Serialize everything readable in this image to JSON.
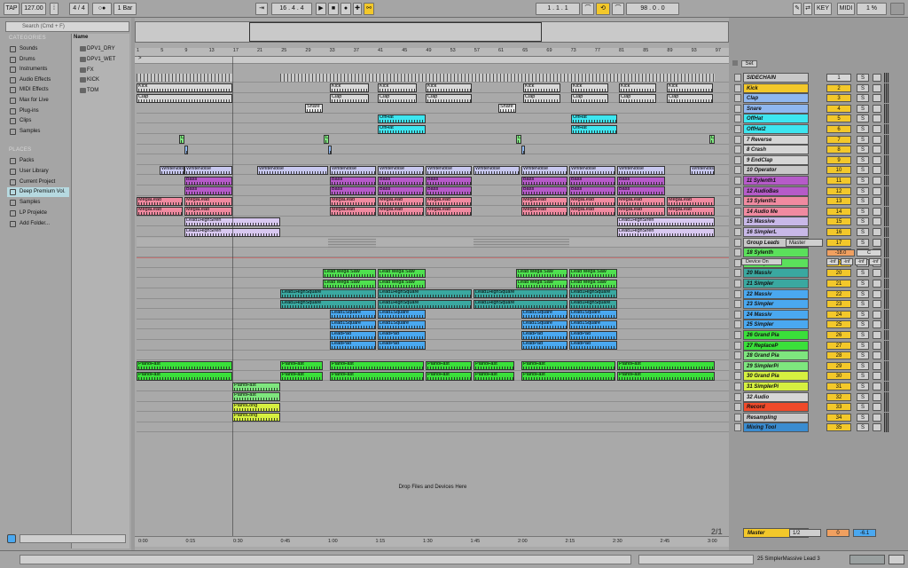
{
  "transport": {
    "tap": "TAP",
    "tempo": "127.00",
    "sig": "4 / 4",
    "bar": "1 Bar",
    "pos": "16 . 4 . 4",
    "loop_start": "1 . 1 . 1",
    "loop_len": "98 . 0 . 0",
    "key": "KEY",
    "midi": "MIDI",
    "cpu": "1 %"
  },
  "browser": {
    "search_placeholder": "Search (Cmd + F)",
    "categories_title": "CATEGORIES",
    "categories": [
      "Sounds",
      "Drums",
      "Instruments",
      "Audio Effects",
      "MIDI Effects",
      "Max for Live",
      "Plug-ins",
      "Clips",
      "Samples"
    ],
    "places_title": "PLACES",
    "places": [
      "Packs",
      "User Library",
      "Current Project",
      "Deep Premium Vol.",
      "Samples",
      "LP Projekte",
      "Add Folder..."
    ],
    "name_header": "Name",
    "folders": [
      "DPV1_DRY",
      "DPV1_WET",
      "FX",
      "KICK",
      "TOM"
    ]
  },
  "ruler": [
    "1",
    "5",
    "9",
    "13",
    "17",
    "21",
    "25",
    "29",
    "33",
    "37",
    "41",
    "45",
    "49",
    "53",
    "57",
    "61",
    "65",
    "69",
    "73",
    "77",
    "81",
    "85",
    "89",
    "93",
    "97"
  ],
  "timeline": [
    "0:00",
    "0:15",
    "0:30",
    "0:45",
    "1:00",
    "1:15",
    "1:30",
    "1:45",
    "2:00",
    "2:15",
    "2:30",
    "2:45",
    "3:00"
  ],
  "drop_hint": "Drop Files and Devices Here",
  "zoom": "2/1",
  "set_label": "Set",
  "tracks": [
    {
      "name": "SIDECHAIN",
      "color": "#c8c8c8",
      "num": "1",
      "gray": true
    },
    {
      "name": "Kick",
      "color": "#f3c82a",
      "num": "2"
    },
    {
      "name": "Clap",
      "color": "#8fb7f0",
      "num": "3"
    },
    {
      "name": "Snare",
      "color": "#8fb7f0",
      "num": "4"
    },
    {
      "name": "OffHat",
      "color": "#3de6f0",
      "num": "5"
    },
    {
      "name": "OffHat2",
      "color": "#3de6f0",
      "num": "6"
    },
    {
      "name": "7 Reverse",
      "color": "#d6d6d6",
      "num": "7"
    },
    {
      "name": "8 Crash",
      "color": "#d6d6d6",
      "num": "8"
    },
    {
      "name": "9 EndClap",
      "color": "#d6d6d6",
      "num": "9"
    },
    {
      "name": "10 Operator",
      "color": "#c8c8c8",
      "num": "10"
    },
    {
      "name": "11 Sylenth1",
      "color": "#b65bc9",
      "num": "11"
    },
    {
      "name": "12 AudioBas",
      "color": "#b65bc9",
      "num": "12"
    },
    {
      "name": "13 Sylenth1",
      "color": "#f08aa0",
      "num": "13"
    },
    {
      "name": "14 Audio Me",
      "color": "#f08aa0",
      "num": "14"
    },
    {
      "name": "15 Massive",
      "color": "#c8b8e8",
      "num": "15"
    },
    {
      "name": "16 SimplerL",
      "color": "#c8b8e8",
      "num": "16"
    },
    {
      "name": "Group Leads",
      "color": "#c8c8c8",
      "num": "17",
      "group": "Master"
    },
    {
      "name": "18 Sylenth",
      "color": "#5be05b",
      "num": "18"
    },
    {
      "name": "19 Simpler",
      "color": "#5be05b",
      "num": "19"
    },
    {
      "name": "20 Massiv",
      "color": "#3aa8a0",
      "num": "20"
    },
    {
      "name": "21 Simpler",
      "color": "#3aa8a0",
      "num": "21"
    },
    {
      "name": "22 Massiv",
      "color": "#4aa8f0",
      "num": "22"
    },
    {
      "name": "23 Simpler",
      "color": "#4aa8f0",
      "num": "23"
    },
    {
      "name": "24 Massiv",
      "color": "#4aa8f0",
      "num": "24"
    },
    {
      "name": "25 Simpler",
      "color": "#4aa8f0",
      "num": "25"
    },
    {
      "name": "26 Grand Pia",
      "color": "#3ae03a",
      "num": "26"
    },
    {
      "name": "27 ReplaceP",
      "color": "#3ae03a",
      "num": "27"
    },
    {
      "name": "28 Grand Pia",
      "color": "#7ee67e",
      "num": "28"
    },
    {
      "name": "29 SimplerPi",
      "color": "#7ee67e",
      "num": "29"
    },
    {
      "name": "30 Grand Pia",
      "color": "#d6f040",
      "num": "30"
    },
    {
      "name": "31 SimplerPi",
      "color": "#d6f040",
      "num": "31"
    },
    {
      "name": "32 Audio",
      "color": "#d6d6d6",
      "num": "32"
    },
    {
      "name": "Record",
      "color": "#f04a2a",
      "num": "33"
    },
    {
      "name": "Resampling",
      "color": "#c8c8c8",
      "num": "34"
    },
    {
      "name": "Mixing Tool",
      "color": "#3a8cd0",
      "num": "35"
    }
  ],
  "master": {
    "name": "Master",
    "sel": "1/2",
    "vol": "0",
    "pan": "-6.1"
  },
  "group_leads": {
    "vol": "-18.0",
    "pan": "C",
    "device": "Device On",
    "inf": "-inf"
  },
  "status": "25 SimplerMassive Lead 3",
  "colors": {
    "accent": "#f3c82a"
  },
  "clips": [
    {
      "lane": 1,
      "label": "Kick",
      "c": "#d8d8d8",
      "x": [
        [
          154,
          262
        ],
        [
          372,
          416
        ],
        [
          426,
          470
        ],
        [
          480,
          532
        ],
        [
          590,
          632
        ],
        [
          644,
          686
        ],
        [
          698,
          740
        ],
        [
          752,
          804
        ]
      ]
    },
    {
      "lane": 2,
      "label": "Clap",
      "c": "#d8d8d8",
      "x": [
        [
          154,
          262
        ],
        [
          372,
          416
        ],
        [
          426,
          470
        ],
        [
          480,
          532
        ],
        [
          590,
          632
        ],
        [
          644,
          686
        ],
        [
          698,
          740
        ],
        [
          752,
          804
        ]
      ]
    },
    {
      "lane": 3,
      "label": "Snare",
      "c": "#e8e8e8",
      "x": [
        [
          344,
          364
        ],
        [
          562,
          582
        ]
      ]
    },
    {
      "lane": 4,
      "label": "OffHat",
      "c": "#3de6f0",
      "x": [
        [
          426,
          480
        ],
        [
          644,
          696
        ]
      ]
    },
    {
      "lane": 5,
      "label": "OffHat",
      "c": "#3de6f0",
      "x": [
        [
          426,
          480
        ],
        [
          644,
          696
        ]
      ]
    },
    {
      "lane": 6,
      "label": "D",
      "c": "#7ee67e",
      "x": [
        [
          202,
          208
        ],
        [
          365,
          371
        ],
        [
          582,
          588
        ],
        [
          800,
          806
        ]
      ]
    },
    {
      "lane": 7,
      "label": "",
      "c": "#8fb7f0",
      "x": [
        [
          208,
          212
        ],
        [
          370,
          374
        ],
        [
          588,
          592
        ]
      ]
    },
    {
      "lane": 9,
      "label": "WhiteNoise",
      "c": "#c8c8f0",
      "x": [
        [
          180,
          208
        ],
        [
          208,
          262
        ],
        [
          290,
          370
        ],
        [
          372,
          424
        ],
        [
          426,
          478
        ],
        [
          480,
          532
        ],
        [
          534,
          586
        ],
        [
          588,
          640
        ],
        [
          642,
          694
        ],
        [
          696,
          750
        ],
        [
          778,
          806
        ]
      ]
    },
    {
      "lane": 10,
      "label": "Bass",
      "c": "#b65bc9",
      "x": [
        [
          208,
          262
        ],
        [
          372,
          424
        ],
        [
          426,
          478
        ],
        [
          480,
          532
        ],
        [
          588,
          640
        ],
        [
          642,
          694
        ],
        [
          696,
          750
        ]
      ]
    },
    {
      "lane": 11,
      "label": "Bass",
      "c": "#b65bc9",
      "x": [
        [
          208,
          262
        ],
        [
          372,
          424
        ],
        [
          426,
          478
        ],
        [
          480,
          532
        ],
        [
          588,
          640
        ],
        [
          642,
          694
        ],
        [
          696,
          750
        ]
      ]
    },
    {
      "lane": 12,
      "label": "MegaLead",
      "c": "#f08aa0",
      "x": [
        [
          154,
          206
        ],
        [
          208,
          262
        ],
        [
          372,
          424
        ],
        [
          426,
          478
        ],
        [
          480,
          532
        ],
        [
          588,
          640
        ],
        [
          642,
          694
        ],
        [
          696,
          750
        ],
        [
          752,
          806
        ]
      ]
    },
    {
      "lane": 13,
      "label": "MegaLead",
      "c": "#f08aa0",
      "x": [
        [
          154,
          206
        ],
        [
          208,
          262
        ],
        [
          372,
          424
        ],
        [
          426,
          478
        ],
        [
          480,
          532
        ],
        [
          588,
          640
        ],
        [
          642,
          694
        ],
        [
          696,
          750
        ],
        [
          752,
          806
        ]
      ]
    },
    {
      "lane": 14,
      "label": "Lead1HighSiren",
      "c": "#d8c8f0",
      "x": [
        [
          208,
          316
        ],
        [
          696,
          806
        ]
      ]
    },
    {
      "lane": 15,
      "label": "Lead1HighSiren",
      "c": "#d8c8f0",
      "x": [
        [
          208,
          316
        ],
        [
          696,
          806
        ]
      ]
    },
    {
      "lane": 19,
      "label": "Lead Mega Saw",
      "c": "#4fe04f",
      "x": [
        [
          364,
          424
        ],
        [
          426,
          480
        ],
        [
          582,
          640
        ],
        [
          642,
          696
        ]
      ]
    },
    {
      "lane": 20,
      "label": "Lead Mega Saw",
      "c": "#4fe04f",
      "x": [
        [
          364,
          424
        ],
        [
          426,
          480
        ],
        [
          582,
          640
        ],
        [
          642,
          696
        ]
      ]
    },
    {
      "lane": 21,
      "label": "Lead1HighSquare",
      "c": "#3aa8a0",
      "x": [
        [
          316,
          424
        ],
        [
          426,
          532
        ],
        [
          534,
          640
        ],
        [
          642,
          696
        ]
      ]
    },
    {
      "lane": 22,
      "label": "Lead1HighSquare",
      "c": "#3aa8a0",
      "x": [
        [
          316,
          424
        ],
        [
          426,
          532
        ],
        [
          534,
          640
        ],
        [
          642,
          696
        ]
      ]
    },
    {
      "lane": 23,
      "label": "Lead1Square",
      "c": "#4aa8f0",
      "x": [
        [
          372,
          424
        ],
        [
          426,
          480
        ],
        [
          588,
          640
        ],
        [
          642,
          696
        ]
      ]
    },
    {
      "lane": 24,
      "label": "Lead1Square",
      "c": "#4aa8f0",
      "x": [
        [
          372,
          424
        ],
        [
          426,
          480
        ],
        [
          588,
          640
        ],
        [
          642,
          696
        ]
      ]
    },
    {
      "lane": 25,
      "label": "LeadPad",
      "c": "#4aa8f0",
      "x": [
        [
          372,
          424
        ],
        [
          426,
          480
        ],
        [
          588,
          640
        ],
        [
          642,
          696
        ]
      ]
    },
    {
      "lane": 26,
      "label": "LeadPad",
      "c": "#4aa8f0",
      "x": [
        [
          372,
          424
        ],
        [
          426,
          480
        ],
        [
          588,
          640
        ],
        [
          642,
          696
        ]
      ]
    },
    {
      "lane": 28,
      "label": "PianoFast",
      "c": "#3ae03a",
      "x": [
        [
          154,
          262
        ],
        [
          316,
          364
        ],
        [
          372,
          478
        ],
        [
          480,
          532
        ],
        [
          534,
          580
        ],
        [
          588,
          694
        ],
        [
          696,
          806
        ]
      ]
    },
    {
      "lane": 29,
      "label": "PianoFast",
      "c": "#3ae03a",
      "x": [
        [
          154,
          262
        ],
        [
          316,
          364
        ],
        [
          372,
          478
        ],
        [
          480,
          532
        ],
        [
          534,
          580
        ],
        [
          588,
          694
        ],
        [
          696,
          806
        ]
      ]
    },
    {
      "lane": 30,
      "label": "PianoFast",
      "c": "#7ee67e",
      "x": [
        [
          262,
          316
        ]
      ]
    },
    {
      "lane": 31,
      "label": "PianoFast",
      "c": "#7ee67e",
      "x": [
        [
          262,
          316
        ]
      ]
    },
    {
      "lane": 32,
      "label": "PianoLong",
      "c": "#d6f040",
      "x": [
        [
          262,
          316
        ]
      ]
    },
    {
      "lane": 33,
      "label": "PianoLong",
      "c": "#d6f040",
      "x": [
        [
          262,
          316
        ]
      ]
    }
  ]
}
